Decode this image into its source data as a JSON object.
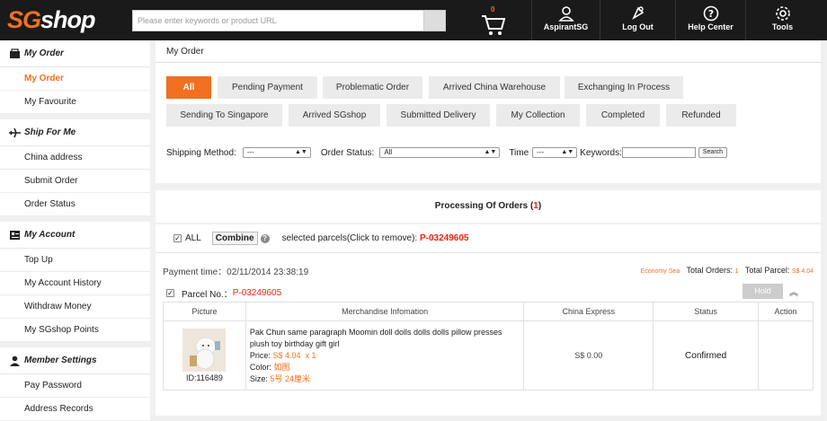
{
  "header": {
    "logo_part1": "SG",
    "logo_part2": "shop",
    "search_placeholder": "Please enter keywords or product URL",
    "cart_count": "0",
    "nav": [
      {
        "label": "AspirantSG",
        "icon": "user-icon"
      },
      {
        "label": "Log Out",
        "icon": "logout-icon"
      },
      {
        "label": "Help Center",
        "icon": "help-icon"
      },
      {
        "label": "Tools",
        "icon": "gear-icon"
      }
    ]
  },
  "sidebar": {
    "sections": [
      {
        "title": "My Order",
        "icon": "order-icon",
        "items": [
          "My Order",
          "My Favourite"
        ]
      },
      {
        "title": "Ship For Me",
        "icon": "plane-icon",
        "items": [
          "China address",
          "Submit Order",
          "Order Status"
        ]
      },
      {
        "title": "My Account",
        "icon": "account-icon",
        "items": [
          "Top Up",
          "My Account History",
          "Withdraw Money",
          "My SGshop Points"
        ]
      },
      {
        "title": "Member Settings",
        "icon": "person-icon",
        "items": [
          "Pay Password",
          "Address Records"
        ]
      }
    ],
    "active_item": "My Order"
  },
  "main": {
    "breadcrumb": "My Order",
    "tabs_row1": [
      "All",
      "Pending Payment",
      "Problematic Order",
      "Arrived China Warehouse",
      "Exchanging In Process"
    ],
    "tabs_row2": [
      "Sending To Singapore",
      "Arrived SGshop",
      "Submitted Delivery",
      "My Collection",
      "Completed",
      "Refunded"
    ],
    "filters": {
      "shipping_label": "Shipping Method:",
      "shipping_value": "---",
      "status_label": "Order Status:",
      "status_value": "All",
      "time_label": "Time",
      "time_value": "---",
      "keywords_label": "Keywords:",
      "search_button": "Search"
    },
    "processing": {
      "label": "Processing Of Orders",
      "count_open": "(",
      "count": "1",
      "count_close": ")"
    },
    "combine_bar": {
      "all_label": "ALL",
      "combine_button": "Combine",
      "help": "?",
      "selected_text": "selected parcels(Click to remove):",
      "selected_id": "P-03249605"
    },
    "order": {
      "payment_time": "Payment time：02/11/2014 23:38:19",
      "shipping": "Economy Sea",
      "total_orders_label": "Total Orders:",
      "total_orders": "1",
      "total_parcel_label": "Total Parcel:",
      "total_parcel": "S$ 4.04",
      "parcel_label": "Parcel No.：",
      "parcel_no": "P-03249605",
      "hold_button": "Hold",
      "collapse": "︽"
    },
    "table": {
      "headers": [
        "Picture",
        "Merchandise Infomation",
        "China Express",
        "Status",
        "Action"
      ],
      "row": {
        "id": "ID:116489",
        "title": "Pak Chun same paragraph Moomin doll dolls dolls dolls pillow presses plush toy birthday gift girl",
        "price_label": "Price:",
        "price": "S$ 4.04",
        "qty": "x  1",
        "color_label": "Color:",
        "color": "如图",
        "size_label": "Size:",
        "size": "5号 24厘米",
        "express": "S$ 0.00",
        "status": "Confirmed"
      }
    }
  },
  "colors": {
    "accent": "#f07020",
    "red": "#e21111",
    "dark": "#1a1a1a"
  }
}
